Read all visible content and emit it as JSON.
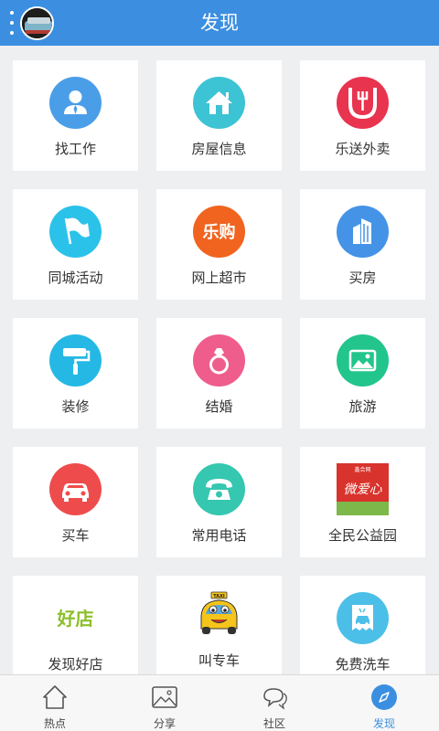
{
  "header": {
    "title": "发现"
  },
  "tiles": [
    {
      "label": "找工作"
    },
    {
      "label": "房屋信息"
    },
    {
      "label": "乐送外卖"
    },
    {
      "label": "同城活动"
    },
    {
      "label": "网上超市",
      "icon_text": "乐购"
    },
    {
      "label": "买房"
    },
    {
      "label": "装修"
    },
    {
      "label": "结婚"
    },
    {
      "label": "旅游"
    },
    {
      "label": "买车"
    },
    {
      "label": "常用电话"
    },
    {
      "label": "全民公益园",
      "icon_text": "微爱心",
      "icon_small": "鑫合网"
    },
    {
      "label": "发现好店",
      "icon_text": "好店"
    },
    {
      "label": "叫专车",
      "icon_text": "TAXI"
    },
    {
      "label": "免费洗车"
    }
  ],
  "tabs": [
    {
      "label": "热点"
    },
    {
      "label": "分享"
    },
    {
      "label": "社区"
    },
    {
      "label": "发现",
      "active": true
    }
  ],
  "colors": {
    "header": "#3c8fe0",
    "active_tab": "#3c8fe0"
  }
}
